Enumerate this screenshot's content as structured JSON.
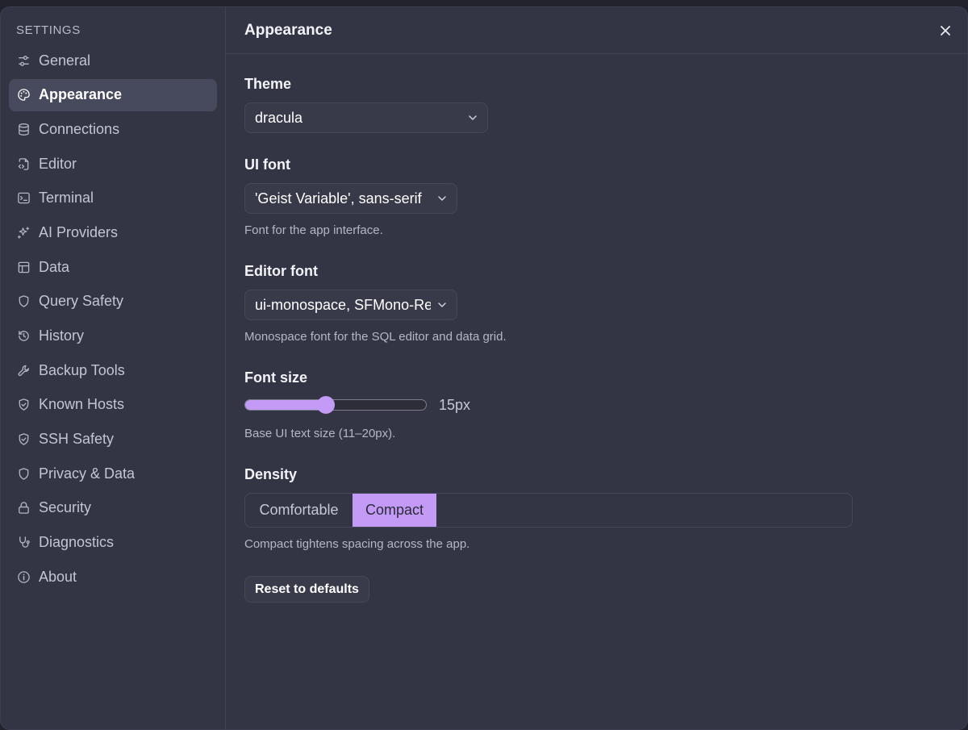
{
  "sidebar": {
    "title": "SETTINGS",
    "items": [
      {
        "label": "General",
        "icon": "sliders-icon",
        "active": false
      },
      {
        "label": "Appearance",
        "icon": "palette-icon",
        "active": true
      },
      {
        "label": "Connections",
        "icon": "database-icon",
        "active": false
      },
      {
        "label": "Editor",
        "icon": "code-file-icon",
        "active": false
      },
      {
        "label": "Terminal",
        "icon": "terminal-icon",
        "active": false
      },
      {
        "label": "AI Providers",
        "icon": "sparkles-icon",
        "active": false
      },
      {
        "label": "Data",
        "icon": "table-icon",
        "active": false
      },
      {
        "label": "Query Safety",
        "icon": "shield-icon",
        "active": false
      },
      {
        "label": "History",
        "icon": "history-icon",
        "active": false
      },
      {
        "label": "Backup Tools",
        "icon": "wrench-icon",
        "active": false
      },
      {
        "label": "Known Hosts",
        "icon": "shield-check-icon",
        "active": false
      },
      {
        "label": "SSH Safety",
        "icon": "shield-check-icon",
        "active": false
      },
      {
        "label": "Privacy & Data",
        "icon": "shield-icon",
        "active": false
      },
      {
        "label": "Security",
        "icon": "lock-icon",
        "active": false
      },
      {
        "label": "Diagnostics",
        "icon": "stethoscope-icon",
        "active": false
      },
      {
        "label": "About",
        "icon": "info-icon",
        "active": false
      }
    ]
  },
  "main": {
    "title": "Appearance",
    "theme": {
      "label": "Theme",
      "value": "dracula"
    },
    "ui_font": {
      "label": "UI font",
      "value": "'Geist Variable', sans-serif",
      "help": "Font for the app interface."
    },
    "editor_font": {
      "label": "Editor font",
      "value": "ui-monospace, SFMono-Regular",
      "help": "Monospace font for the SQL editor and data grid."
    },
    "font_size": {
      "label": "Font size",
      "value_text": "15px",
      "value": 15,
      "min": 11,
      "max": 20,
      "help": "Base UI text size (11–20px)."
    },
    "density": {
      "label": "Density",
      "options": [
        "Comfortable",
        "Compact"
      ],
      "selected": "Compact",
      "help": "Compact tightens spacing across the app."
    },
    "reset_label": "Reset to defaults"
  },
  "colors": {
    "accent": "#c39bf6",
    "background": "#333544",
    "sidebar_active": "#474a5c"
  }
}
